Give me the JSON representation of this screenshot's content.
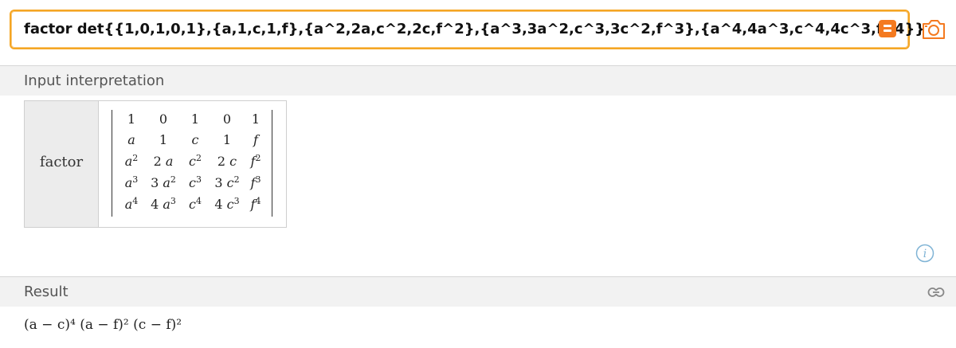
{
  "query": {
    "value": "factor det{{1,0,1,0,1},{a,1,c,1,f},{a^2,2a,c^2,2c,f^2},{a^3,3a^2,c^3,3c^2,f^3},{a^4,4a^3,c^4,4c^3,f^4}}"
  },
  "input_interpretation": {
    "title": "Input interpretation",
    "label": "factor",
    "matrix": [
      [
        "1",
        "0",
        "1",
        "0",
        "1"
      ],
      [
        "a",
        "1",
        "c",
        "1",
        "f"
      ],
      [
        "a2",
        "2 a",
        "c2",
        "2 c",
        "f2"
      ],
      [
        "a3",
        "3 a2",
        "c3",
        "3 c2",
        "f3"
      ],
      [
        "a4",
        "4 a3",
        "c4",
        "4 c3",
        "f4"
      ]
    ]
  },
  "result": {
    "title": "Result",
    "value": "(a − c)⁴ (a − f)² (c − f)²"
  },
  "icons": {
    "equals": "equals-icon",
    "camera": "camera-icon",
    "info": "info-icon",
    "link": "link-icon"
  },
  "colors": {
    "accent": "#f5a623",
    "button": "#f47a20",
    "info": "#7fb3d5"
  }
}
